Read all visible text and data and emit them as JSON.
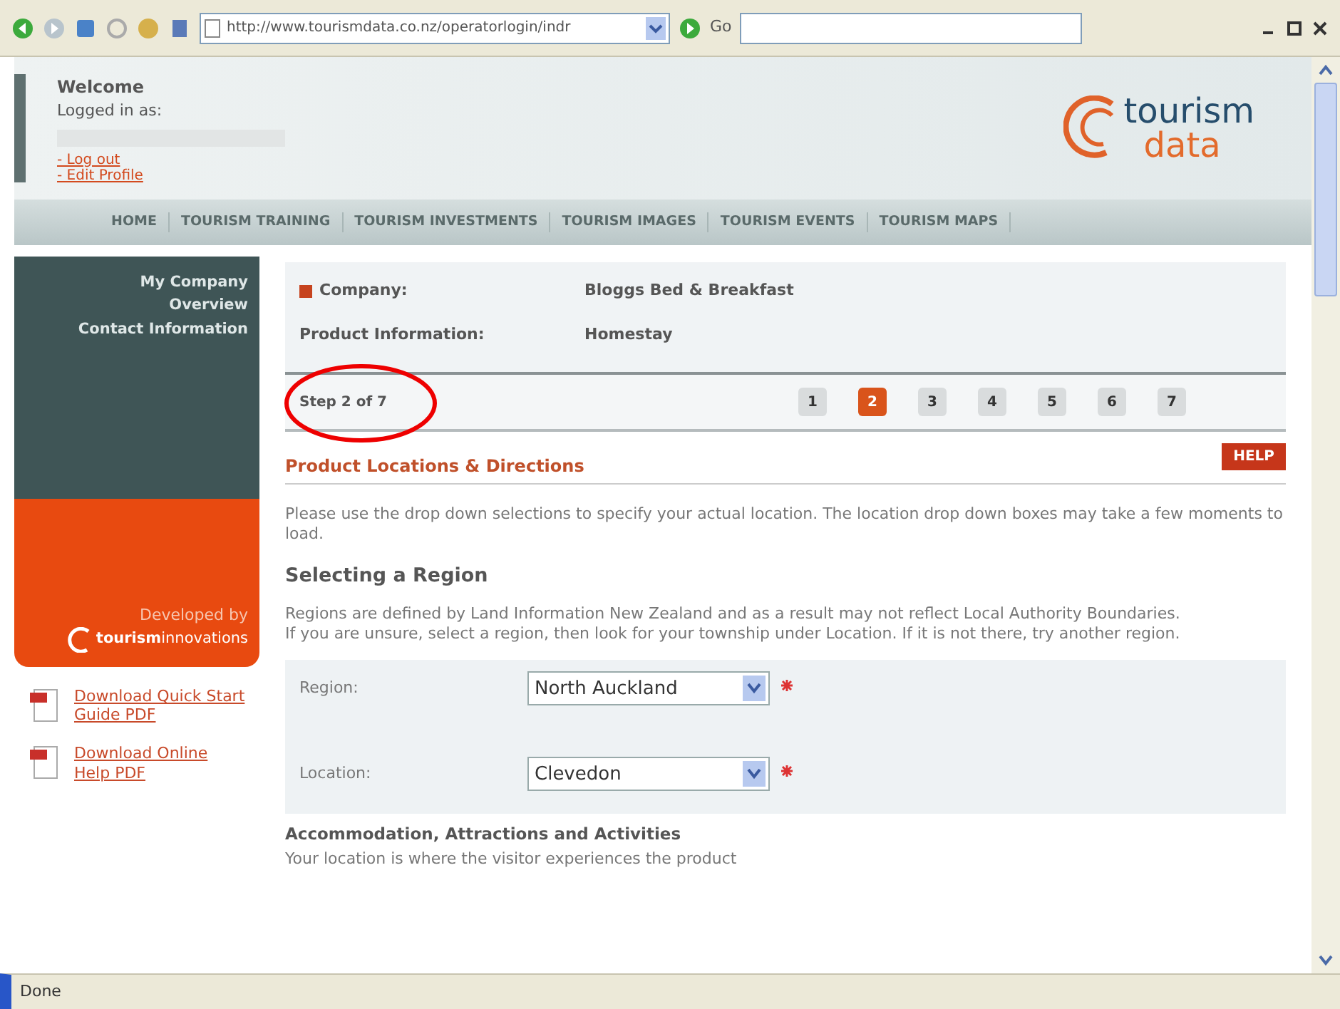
{
  "browser": {
    "address": "http://www.tourismdata.co.nz/operatorlogin/indr",
    "go_label": "Go"
  },
  "header": {
    "welcome": "Welcome",
    "logged_in": "Logged in as:",
    "links": [
      "- Log out",
      "- Edit Profile"
    ],
    "logo": [
      "tourism",
      "data"
    ]
  },
  "nav": [
    "HOME",
    "TOURISM TRAINING",
    "TOURISM INVESTMENTS",
    "TOURISM IMAGES",
    "TOURISM EVENTS",
    "TOURISM MAPS"
  ],
  "sidebar": {
    "links": [
      "My Company",
      "Overview",
      "Contact Information"
    ],
    "developed_by": "Developed by",
    "brand": "**tourism**innovations",
    "downloads": [
      "Download Quick Start Guide PDF",
      "Download Online Help PDF"
    ]
  },
  "summary": [
    {
      "label": "Company:",
      "value": "Bloggs Bed & Breakfast",
      "marker": true
    },
    {
      "label": "Product Information:",
      "value": "Homestay",
      "marker": false
    }
  ],
  "step_text": "Step 2 of 7",
  "steps": [
    {
      "label": "1",
      "selected": false
    },
    {
      "label": "2",
      "selected": true
    },
    {
      "label": "3",
      "selected": false
    },
    {
      "label": "4",
      "selected": false
    },
    {
      "label": "5",
      "selected": false
    },
    {
      "label": "6",
      "selected": false
    },
    {
      "label": "7",
      "selected": false
    }
  ],
  "section_title": "Product Locations & Directions",
  "help": "HELP",
  "intro": "Please use the drop down selections to specify your actual location. The location drop down boxes may take a few moments to load.",
  "region_heading": "Selecting a Region",
  "region_notes": [
    "Regions are defined by Land Information New Zealand and as a result may not reflect Local Authority Boundaries.",
    "If you are unsure, select a region, then look for your township under Location. If it is not there, try another region."
  ],
  "form": [
    {
      "label": "Region:",
      "value": "North Auckland",
      "required": true
    },
    {
      "label": "Location:",
      "value": "Clevedon",
      "required": true
    }
  ],
  "accommodation_heading": "Accommodation, Attractions and Activities",
  "accommodation_note": "Your location is where the visitor experiences the product",
  "status": "Done"
}
